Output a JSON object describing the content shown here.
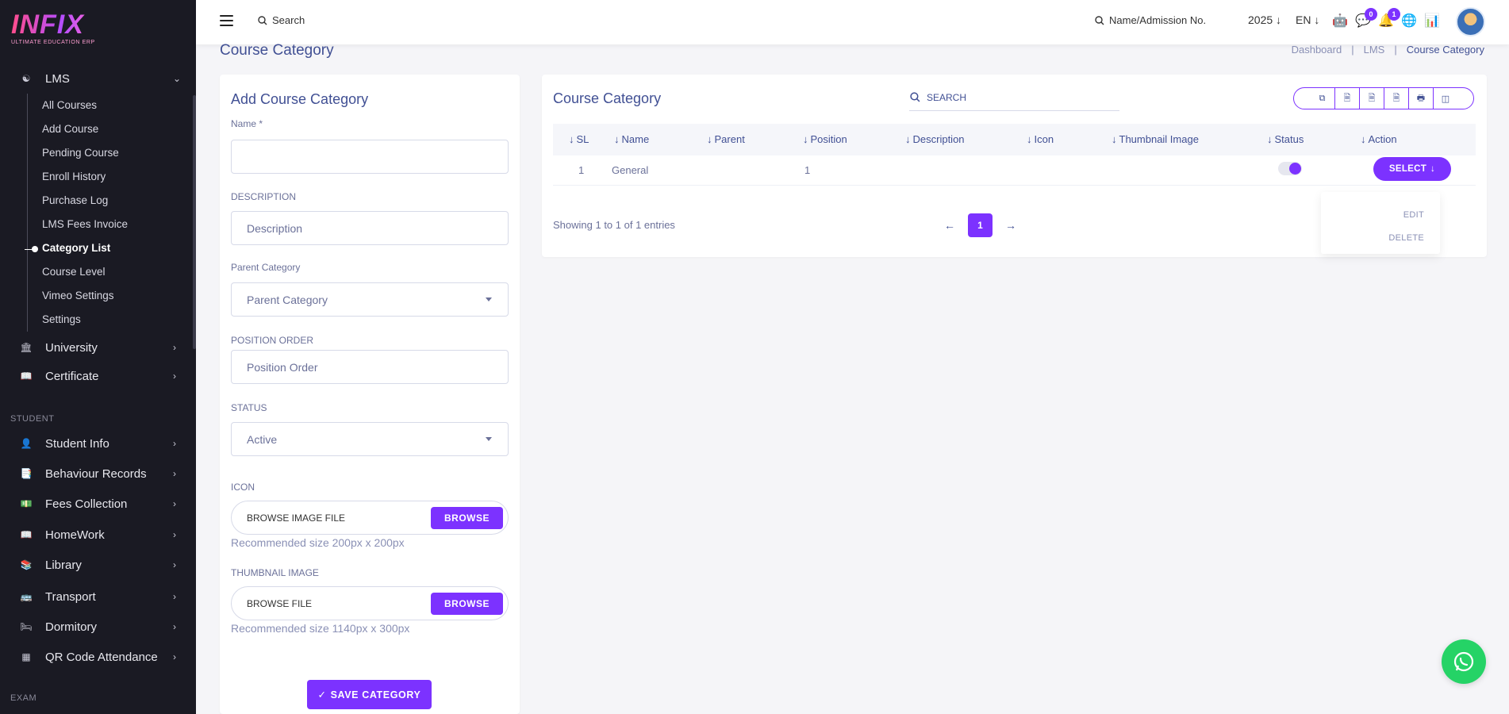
{
  "brand": {
    "logo_text": "INFIX",
    "tagline": "ULTIMATE EDUCATION ERP"
  },
  "sidebar": {
    "lms_label": "LMS",
    "lms_items": [
      "All Courses",
      "Add Course",
      "Pending Course",
      "Enroll History",
      "Purchase Log",
      "LMS Fees Invoice",
      "Category List",
      "Course Level",
      "Vimeo Settings",
      "Settings"
    ],
    "active_item": "Category List",
    "university_label": "University",
    "certificate_label": "Certificate",
    "section_student": "STUDENT",
    "student_items": [
      "Student Info",
      "Behaviour Records",
      "Fees Collection",
      "HomeWork",
      "Library",
      "Transport",
      "Dormitory",
      "QR Code Attendance"
    ],
    "section_exam": "EXAM"
  },
  "header": {
    "search_label": "Search",
    "student_search_label": "Name/Admission No.",
    "year": "2025",
    "language": "EN",
    "messages_count": "0",
    "notifications_count": "1"
  },
  "page": {
    "title": "Course Category",
    "breadcrumb": [
      "Dashboard",
      "LMS",
      "Course Category"
    ]
  },
  "form": {
    "title": "Add Course Category",
    "name_label": "Name *",
    "name_value": "",
    "description_label": "DESCRIPTION",
    "description_placeholder": "Description",
    "parent_label": "Parent Category",
    "parent_value": "Parent Category",
    "position_label": "POSITION ORDER",
    "position_placeholder": "Position Order",
    "status_label": "STATUS",
    "status_value": "Active",
    "icon_label": "ICON",
    "icon_file_text": "BROWSE IMAGE FILE",
    "icon_browse": "BROWSE",
    "icon_hint": "Recommended size 200px x 200px",
    "thumb_label": "THUMBNAIL IMAGE",
    "thumb_file_text": "BROWSE FILE",
    "thumb_browse": "BROWSE",
    "thumb_hint": "Recommended size 1140px x 300px",
    "save_label": "SAVE CATEGORY"
  },
  "table": {
    "title": "Course Category",
    "search_label": "SEARCH",
    "columns": [
      "SL",
      "Name",
      "Parent",
      "Position",
      "Description",
      "Icon",
      "Thumbnail Image",
      "Status",
      "Action"
    ],
    "rows": [
      {
        "sl": "1",
        "name": "General",
        "parent": "",
        "position": "1",
        "description": "",
        "icon": "",
        "thumbnail": "",
        "status_on": true
      }
    ],
    "select_label": "SELECT",
    "menu": [
      "EDIT",
      "DELETE"
    ],
    "showing": "Showing 1 to 1 of 1 entries",
    "current_page": "1"
  },
  "colors": {
    "accent": "#7c32ff",
    "sidebar_bg": "#1a1a23",
    "text": "#415094",
    "whatsapp": "#25d366"
  }
}
